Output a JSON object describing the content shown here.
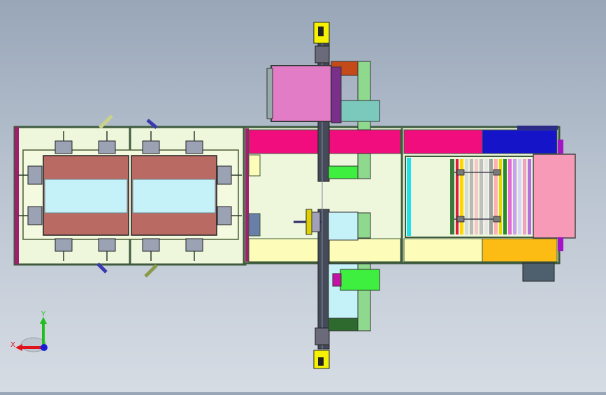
{
  "triad": {
    "x_label": "X",
    "y_label": "Y"
  },
  "colors": {
    "frame": "#3d5a3d",
    "panel_green": "#eef7dc",
    "table_red": "#b86a63",
    "table_cyan": "#c4f2f8",
    "magenta": "#f20d7f",
    "blue": "#1614c9",
    "cream": "#fdfcb8",
    "orange": "#fcbc13",
    "pink_box": "#e27cc7",
    "teal": "#7ac9bc",
    "lime": "#3fef3f",
    "green_plate": "#8fd98f",
    "axis_red": "#e0121b",
    "axis_green": "#1fbf1f",
    "axis_blue": "#1b1bd9"
  }
}
